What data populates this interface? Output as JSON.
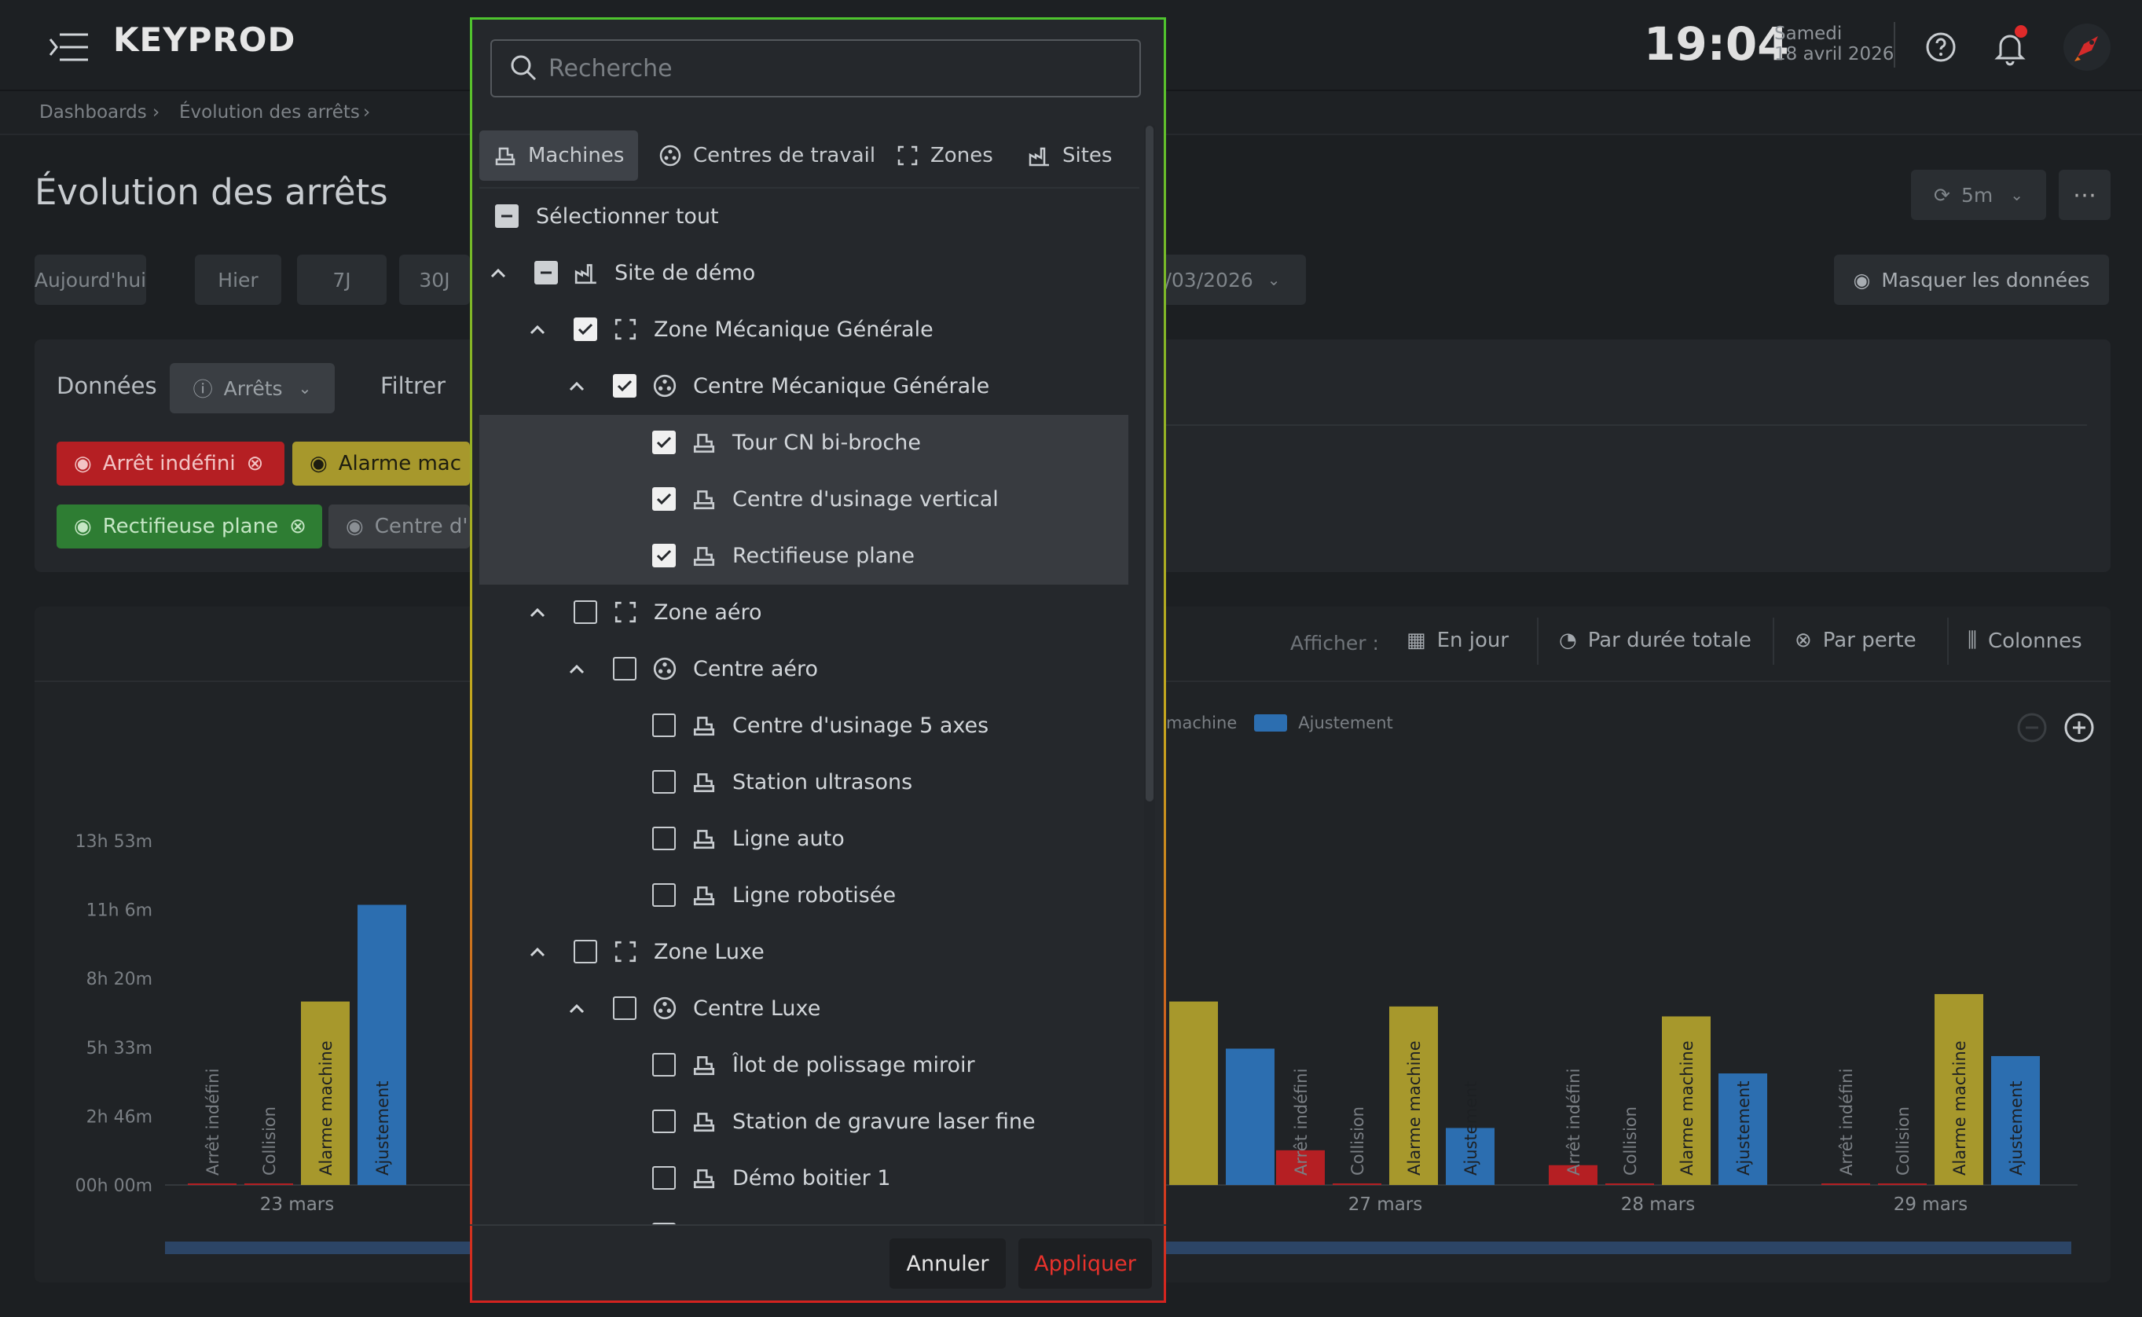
{
  "header": {
    "logo": "KEYPROD",
    "time": "19:04",
    "day_name": "Samedi",
    "date": "18 avril 2026"
  },
  "breadcrumb": [
    "Dashboards",
    "Évolution des arrêts"
  ],
  "page": {
    "title": "Évolution des arrêts",
    "refresh_label": "5m",
    "ranges": [
      "Aujourd'hui",
      "Hier",
      "7J",
      "30J"
    ],
    "date_end": "/03/2026",
    "hide_data_label": "Masquer les données"
  },
  "data_panel": {
    "data_label": "Données",
    "select_value": "Arrêts",
    "filter_label": "Filtrer",
    "chips": [
      {
        "label": "Arrêt indéfini",
        "color": "#b51f23"
      },
      {
        "label": "Alarme mac",
        "color": "#a7982c"
      },
      {
        "label": "Rectifieuse plane",
        "color": "#2e7d33"
      },
      {
        "label": "Centre d'",
        "color": "#3a3d41"
      }
    ]
  },
  "chart_panel": {
    "display_label": "Afficher :",
    "options": [
      "En jour",
      "Par durée totale",
      "Par perte",
      "Colonnes"
    ],
    "legend": [
      {
        "label": "machine",
        "color": "#a7982c"
      },
      {
        "label": "Ajustement",
        "color": "#2c6eb0"
      }
    ]
  },
  "chart_data": {
    "type": "bar",
    "ylabel": "",
    "y_ticks": [
      "00h 00m",
      "2h 46m",
      "5h 33m",
      "8h 20m",
      "11h 6m",
      "13h 53m"
    ],
    "ylim_hours": [
      0,
      13.883
    ],
    "series": [
      {
        "name": "Arrêt indéfini",
        "color": "#b51f23"
      },
      {
        "name": "Collision",
        "color": "#b51f23"
      },
      {
        "name": "Alarme machine",
        "color": "#a7982c"
      },
      {
        "name": "Ajustement",
        "color": "#2c6eb0"
      }
    ],
    "groups": [
      {
        "date": "23 mars",
        "values": [
          0.03,
          0.03,
          7.4,
          11.3
        ]
      },
      {
        "date": "",
        "values": [
          0,
          0,
          7.4,
          5.5
        ]
      },
      {
        "date": "27 mars",
        "values": [
          1.4,
          0.03,
          7.2,
          2.3
        ]
      },
      {
        "date": "28 mars",
        "values": [
          0.8,
          0.03,
          6.8,
          4.5
        ]
      },
      {
        "date": "29 mars",
        "values": [
          0.03,
          0.03,
          7.7,
          5.2
        ]
      }
    ]
  },
  "modal": {
    "search_placeholder": "Recherche",
    "tabs": [
      "Machines",
      "Centres de travail",
      "Zones",
      "Sites"
    ],
    "select_all": "Sélectionner tout",
    "items": [
      {
        "label": "Site de démo",
        "level": 0,
        "type": "site",
        "state": "indeterminate",
        "expandable": true,
        "selected": false
      },
      {
        "label": "Zone Mécanique Générale",
        "level": 1,
        "type": "zone",
        "state": "checked",
        "expandable": true,
        "selected": false
      },
      {
        "label": "Centre Mécanique Générale",
        "level": 2,
        "type": "center",
        "state": "checked",
        "expandable": true,
        "selected": false
      },
      {
        "label": "Tour CN bi-broche",
        "level": 3,
        "type": "machine",
        "state": "checked",
        "expandable": false,
        "selected": true
      },
      {
        "label": "Centre d'usinage vertical",
        "level": 3,
        "type": "machine",
        "state": "checked",
        "expandable": false,
        "selected": true
      },
      {
        "label": "Rectifieuse plane",
        "level": 3,
        "type": "machine",
        "state": "checked",
        "expandable": false,
        "selected": true
      },
      {
        "label": "Zone aéro",
        "level": 1,
        "type": "zone",
        "state": "unchecked",
        "expandable": true,
        "selected": false
      },
      {
        "label": "Centre aéro",
        "level": 2,
        "type": "center",
        "state": "unchecked",
        "expandable": true,
        "selected": false
      },
      {
        "label": "Centre d'usinage 5 axes",
        "level": 3,
        "type": "machine",
        "state": "unchecked",
        "expandable": false,
        "selected": false
      },
      {
        "label": "Station ultrasons",
        "level": 3,
        "type": "machine",
        "state": "unchecked",
        "expandable": false,
        "selected": false
      },
      {
        "label": "Ligne auto",
        "level": 3,
        "type": "machine",
        "state": "unchecked",
        "expandable": false,
        "selected": false
      },
      {
        "label": "Ligne robotisée",
        "level": 3,
        "type": "machine",
        "state": "unchecked",
        "expandable": false,
        "selected": false
      },
      {
        "label": "Zone Luxe",
        "level": 1,
        "type": "zone",
        "state": "unchecked",
        "expandable": true,
        "selected": false
      },
      {
        "label": "Centre Luxe",
        "level": 2,
        "type": "center",
        "state": "unchecked",
        "expandable": true,
        "selected": false
      },
      {
        "label": "Îlot de polissage miroir",
        "level": 3,
        "type": "machine",
        "state": "unchecked",
        "expandable": false,
        "selected": false
      },
      {
        "label": "Station de gravure laser fine",
        "level": 3,
        "type": "machine",
        "state": "unchecked",
        "expandable": false,
        "selected": false
      },
      {
        "label": "Démo boitier 1",
        "level": 3,
        "type": "machine",
        "state": "unchecked",
        "expandable": false,
        "selected": false
      },
      {
        "label": "",
        "level": 3,
        "type": "machine",
        "state": "unchecked",
        "expandable": false,
        "selected": false
      }
    ],
    "cancel_label": "Annuler",
    "apply_label": "Appliquer"
  }
}
